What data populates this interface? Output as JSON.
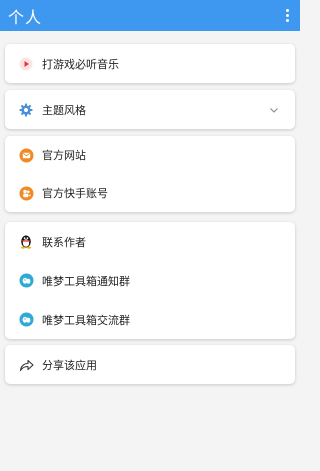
{
  "header": {
    "title": "个人"
  },
  "items": {
    "music": "打游戏必听音乐",
    "theme": "主题风格",
    "website": "官方网站",
    "kuaishou": "官方快手账号",
    "contact": "联系作者",
    "notice_group": "唯梦工具箱通知群",
    "chat_group": "唯梦工具箱交流群",
    "share": "分享该应用"
  },
  "colors": {
    "accent": "#3f98f0",
    "music_red": "#e53935",
    "gear_blue": "#4a90d9",
    "orange": "#f08a24",
    "qq_teal": "#2eaad6"
  },
  "icons": {
    "music": "play-icon",
    "theme": "gear-icon",
    "website": "mail-icon",
    "kuaishou": "kuaishou-icon",
    "contact": "qq-penguin-icon",
    "groups": "qq-group-icon",
    "share": "share-icon"
  }
}
